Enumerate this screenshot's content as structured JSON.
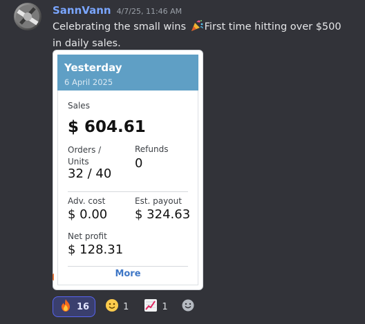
{
  "message": {
    "username": "SannVann",
    "timestamp": "4/7/25, 11:46 AM",
    "text_before": "Celebrating the small wins ",
    "emoji": "party-popper-icon",
    "text_after": "First time hitting over $500 in daily sales."
  },
  "card": {
    "title": "Yesterday",
    "date": "6 April 2025",
    "sales_label": "Sales",
    "sales_value": "$ 604.61",
    "orders_label": "Orders /\nUnits",
    "orders_label_line1": "Orders /",
    "orders_label_line2": "Units",
    "orders_value": "32 / 40",
    "refunds_label": "Refunds",
    "refunds_value": "0",
    "adv_label": "Adv. cost",
    "adv_value": "$ 0.00",
    "payout_label": "Est. payout",
    "payout_value": "$ 324.63",
    "net_label": "Net profit",
    "net_value": "$ 128.31",
    "more_label": "More"
  },
  "reactions": [
    {
      "icon": "fire-icon",
      "count": "16",
      "active": true
    },
    {
      "icon": "smiling-face-icon",
      "count": "1",
      "active": false
    },
    {
      "icon": "chart-increasing-icon",
      "count": "1",
      "active": false
    }
  ],
  "colors": {
    "background": "#323339",
    "username": "#7aa6ff",
    "card_header": "#5f9fc5",
    "link": "#3f77c6",
    "active_reaction": "#5865f2"
  }
}
